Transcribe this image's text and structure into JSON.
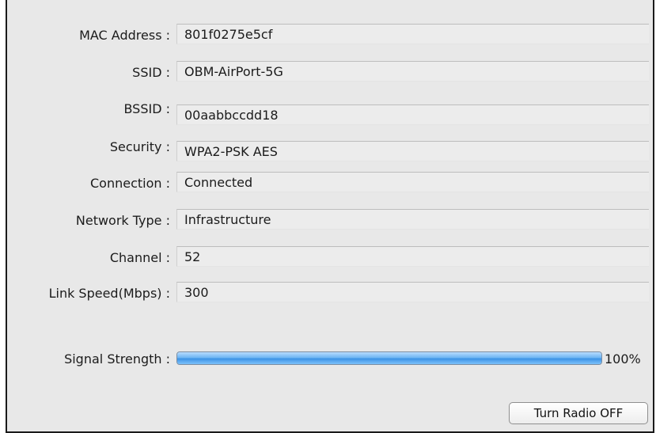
{
  "rows": [
    {
      "label": "MAC Address :",
      "value": "801f0275e5cf"
    },
    {
      "label": "SSID :",
      "value": "OBM-AirPort-5G"
    },
    {
      "label": "BSSID :",
      "value": "00aabbccdd18"
    },
    {
      "label": "Security :",
      "value": "WPA2-PSK AES"
    },
    {
      "label": "Connection :",
      "value": "Connected"
    },
    {
      "label": "Network Type :",
      "value": "Infrastructure"
    },
    {
      "label": "Channel :",
      "value": "52"
    },
    {
      "label": "Link Speed(Mbps) :",
      "value": "300"
    }
  ],
  "signal": {
    "label": "Signal Strength :",
    "percent_text": "100%",
    "level_percent": 100
  },
  "button": {
    "label": "Turn Radio OFF"
  }
}
